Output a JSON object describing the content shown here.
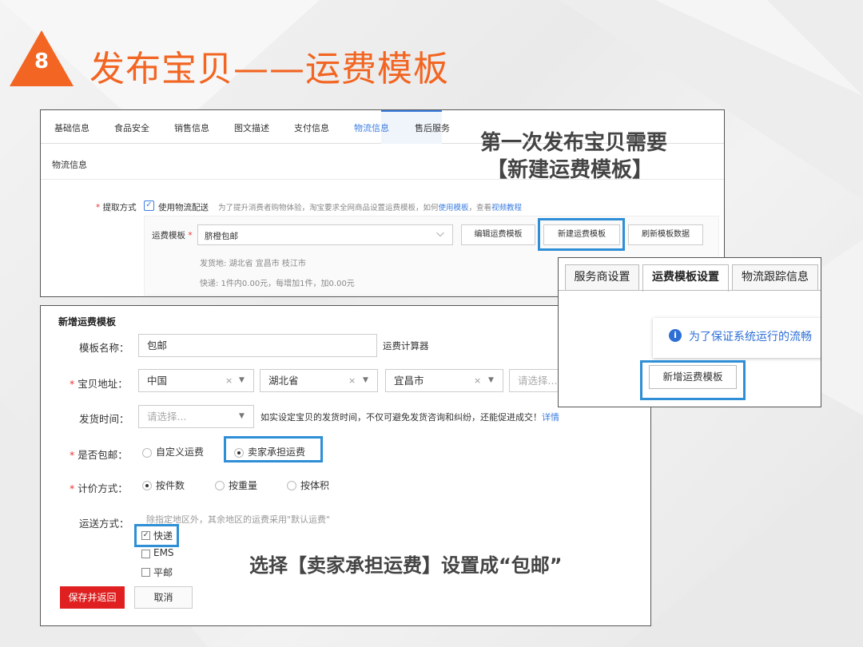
{
  "slide": {
    "number": "8",
    "title": "发布宝贝——运费模板",
    "accent_color": "#f26522",
    "highlight_color": "#2e8fd6"
  },
  "logistics_panel": {
    "tabs": [
      "基础信息",
      "食品安全",
      "销售信息",
      "图文描述",
      "支付信息",
      "物流信息",
      "售后服务"
    ],
    "active_tab": "物流信息",
    "section_title": "物流信息",
    "pickup_label": "提取方式",
    "use_logistics": "使用物流配送",
    "hint_prefix": "为了提升消费者购物体验，淘宝要求全网商品设置运费模板，如何",
    "hint_link1": "使用模板",
    "hint_mid": "，查看",
    "hint_link2": "视频教程",
    "template_label": "运费模板",
    "template_value": "脐橙包邮",
    "edit_button": "编辑运费模板",
    "new_button": "新建运费模板",
    "refresh_button": "刷新模板数据",
    "ship_from": "发货地: 湖北省 宜昌市 枝江市",
    "express_info": "快递: 1件内0.00元，每增加1件，加0.00元"
  },
  "annotation_top": {
    "line1": "第一次发布宝贝需要",
    "line2": "【新建运费模板】"
  },
  "shipping_settings": {
    "tabs": [
      "服务商设置",
      "运费模板设置",
      "物流跟踪信息"
    ],
    "active_tab": "运费模板设置",
    "notice": "为了保证系统运行的流畅",
    "add_button": "新增运费模板"
  },
  "new_template_form": {
    "title": "新增运费模板",
    "name_label": "模板名称：",
    "name_value": "包邮",
    "calculator_link": "运费计算器",
    "address_label": "宝贝地址：",
    "country": "中国",
    "province": "湖北省",
    "city": "宜昌市",
    "district_placeholder": "请选择...",
    "ship_time_label": "发货时间：",
    "ship_time_placeholder": "请选择...",
    "ship_time_hint": "如实设定宝贝的发货时间，不仅可避免发货咨询和纠纷，还能促进成交！",
    "details_link": "详情",
    "free_shipping_label": "是否包邮：",
    "free_options": [
      "自定义运费",
      "卖家承担运费"
    ],
    "free_selected": "卖家承担运费",
    "pricing_label": "计价方式：",
    "pricing_options": [
      "按件数",
      "按重量",
      "按体积"
    ],
    "pricing_selected": "按件数",
    "delivery_label": "运送方式：",
    "delivery_hint": "除指定地区外，其余地区的运费采用\"默认运费\"",
    "delivery_options": [
      "快递",
      "EMS",
      "平邮"
    ],
    "delivery_checked": [
      "快递"
    ],
    "save_button": "保存并返回",
    "cancel_button": "取消"
  },
  "annotation_bottom": "选择【卖家承担运费】设置成“包邮”"
}
